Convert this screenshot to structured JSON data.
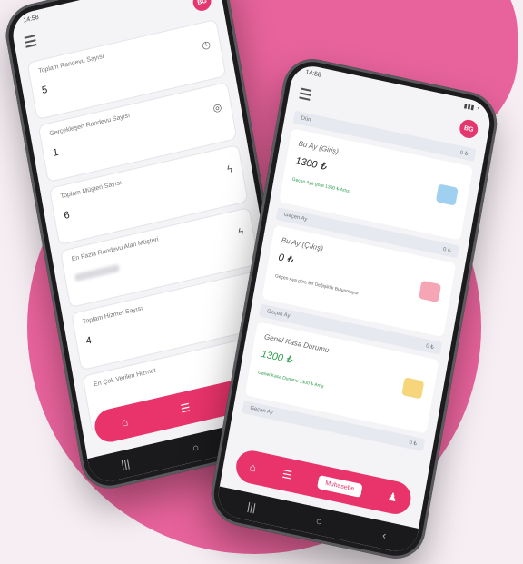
{
  "colors": {
    "accent": "#e8336b",
    "blob": "#e8639c",
    "background": "#f6eef3"
  },
  "left_phone": {
    "status_time": "14:58",
    "avatar_initials": "BG",
    "cards": [
      {
        "label": "Toplam Randevu Sayısı",
        "value": "5",
        "icon": "clock-icon"
      },
      {
        "label": "Gerçekleşen Randevu Sayısı",
        "value": "1",
        "icon": "check-clock-icon"
      },
      {
        "label": "Toplam Müşteri Sayısı",
        "value": "6",
        "icon": "users-icon"
      },
      {
        "label": "En Fazla Randevu Alan Müşteri",
        "value": "",
        "icon": "users-icon"
      },
      {
        "label": "Toplam Hizmet Sayısı",
        "value": "4",
        "icon": "service-icon"
      },
      {
        "label": "En Çok Verilen Hizmet",
        "value": "",
        "icon": ""
      }
    ],
    "nav_icons": [
      "home-icon",
      "list-icon",
      "wallet-icon"
    ]
  },
  "right_phone": {
    "status_time": "14:58",
    "avatar_initials": "BG",
    "strips": [
      {
        "left": "Dün",
        "right": "0 ₺"
      },
      {
        "left": "Geçen Ay",
        "right": "0 ₺"
      },
      {
        "left": "Geçen Ay",
        "right": "0 ₺"
      },
      {
        "left": "Geçen Ay",
        "right": "0 ₺"
      }
    ],
    "cards": [
      {
        "label": "Bu Ay (Giriş)",
        "amount": "1300 ₺",
        "note": "Geçen Aya göre 1300 ₺ Artış",
        "badge_color": "#9fd0f0"
      },
      {
        "label": "Bu Ay (Çıkış)",
        "amount": "0 ₺",
        "note": "Geçen Aya göre Bir Değişiklik Bulunmuyor",
        "badge_color": "#f5a5b3"
      },
      {
        "label": "Genel Kasa Durumu",
        "amount": "1300 ₺",
        "note": "Genel Kasa Durumu 1300 ₺ Artış",
        "badge_color": "#f6d57b"
      }
    ],
    "nav_active_label": "Muhasebe"
  }
}
